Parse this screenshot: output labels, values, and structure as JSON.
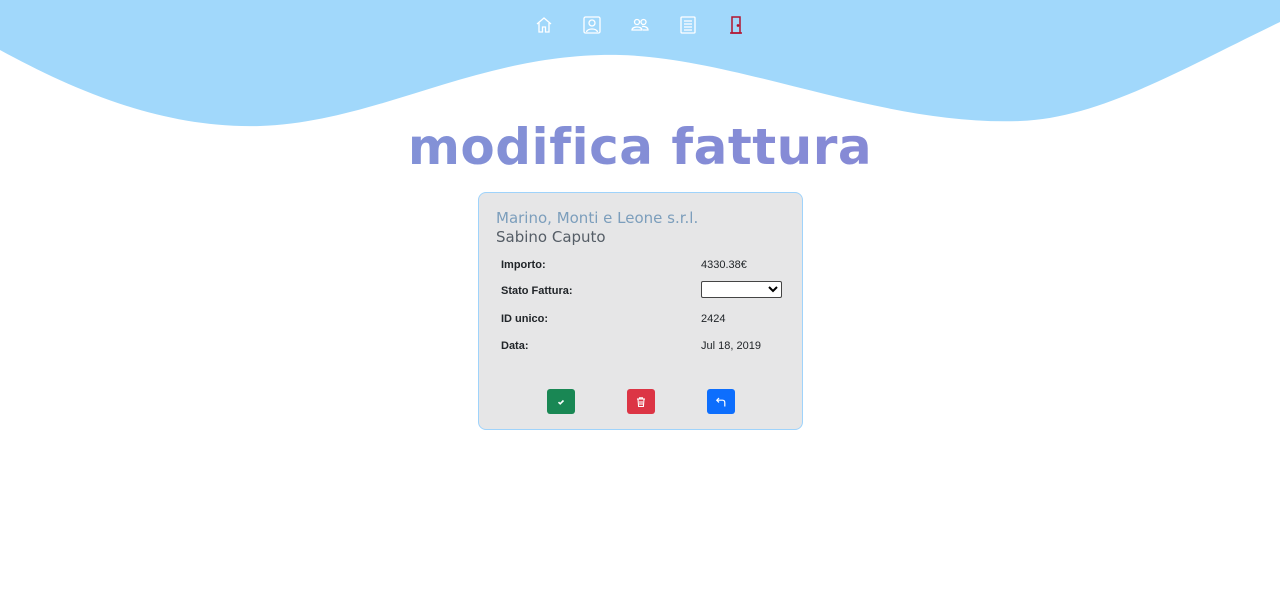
{
  "nav": {
    "items": [
      {
        "icon": "home-icon"
      },
      {
        "icon": "user-profile-icon"
      },
      {
        "icon": "users-icon"
      },
      {
        "icon": "invoice-list-icon"
      },
      {
        "icon": "exit-door-icon"
      }
    ]
  },
  "page": {
    "title": "modifica fattura"
  },
  "invoice": {
    "company": "Marino, Monti e Leone s.r.l.",
    "person": "Sabino Caputo",
    "amount_label": "Importo:",
    "amount_value": "4330.38€",
    "status_label": "Stato Fattura:",
    "status_value": "",
    "id_label": "ID unico:",
    "id_value": "2424",
    "date_label": "Data:",
    "date_value": "Jul 18, 2019"
  },
  "actions": {
    "save": {
      "icon": "check-icon",
      "color": "#198754"
    },
    "delete": {
      "icon": "trash-icon",
      "color": "#dc3545"
    },
    "back": {
      "icon": "return-arrow-icon",
      "color": "#0d6efd"
    }
  },
  "colors": {
    "wave": "#a1d8fb",
    "card_bg": "#e6e6e7",
    "card_border": "#9fd3fb"
  }
}
